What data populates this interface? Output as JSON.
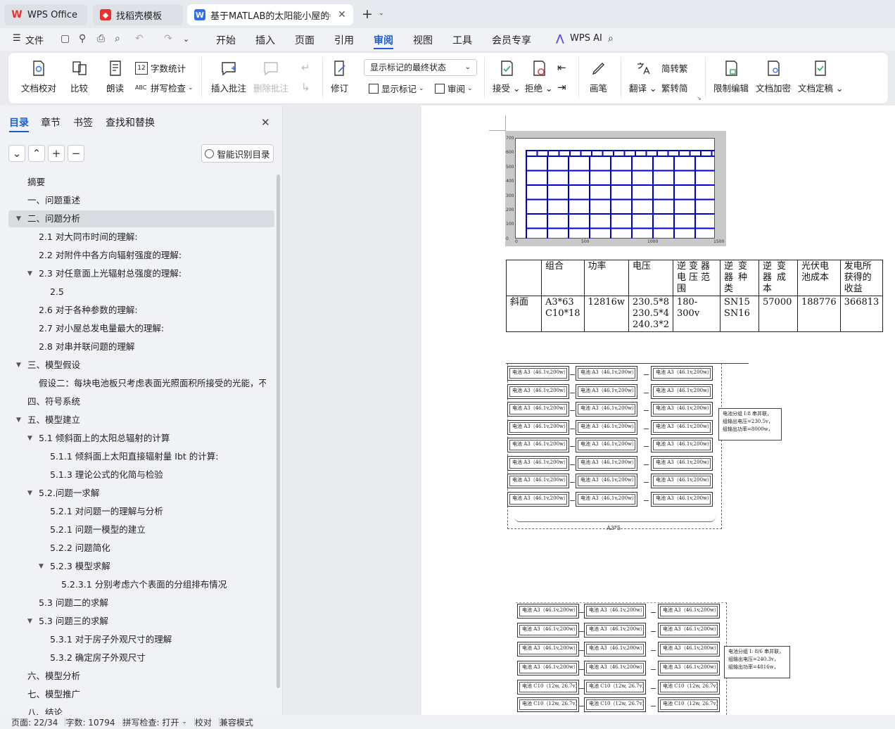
{
  "tabs": [
    {
      "label": "WPS Office"
    },
    {
      "label": "找稻壳模板"
    },
    {
      "label": "基于MATLAB的太阳能小屋的"
    }
  ],
  "menu": {
    "file": "文件",
    "items": [
      "开始",
      "插入",
      "页面",
      "引用",
      "审阅",
      "视图",
      "工具",
      "会员专享"
    ],
    "active": "审阅",
    "ai": "WPS AI"
  },
  "ribbon": {
    "doc_check": "文档校对",
    "compare": "比较",
    "read_aloud": "朗读",
    "word_count": "字数统计",
    "spell_check": "拼写检查",
    "insert_comment": "插入批注",
    "delete_comment": "删除批注",
    "revise": "修订",
    "show_markup_state": "显示标记的最终状态",
    "show_markup": "显示标记",
    "review": "审阅",
    "accept": "接受",
    "reject": "拒绝",
    "pen": "画笔",
    "translate": "翻译",
    "to_traditional": "简转繁",
    "to_simplified": "繁转简",
    "restrict_edit": "限制编辑",
    "encrypt": "文档加密",
    "finalize": "文档定稿"
  },
  "nav": {
    "tabs": [
      "目录",
      "章节",
      "书签",
      "查找和替换"
    ],
    "smart_btn": "智能识别目录",
    "items": [
      {
        "text": "摘要",
        "level": 1,
        "arrow": false
      },
      {
        "text": "一、问题重述",
        "level": 1,
        "arrow": false
      },
      {
        "text": "二、问题分析",
        "level": 1,
        "arrow": true,
        "selected": true
      },
      {
        "text": "2.1 对大同市时间的理解:",
        "level": 2,
        "arrow": false
      },
      {
        "text": "2.2 对附件中各方向辐射强度的理解:",
        "level": 2,
        "arrow": false
      },
      {
        "text": "2.3 对任意面上光辐射总强度的理解:",
        "level": 2,
        "arrow": true
      },
      {
        "text": "2.5",
        "level": 3,
        "arrow": false
      },
      {
        "text": "2.6 对于各种参数的理解:",
        "level": 2,
        "arrow": false
      },
      {
        "text": "2.7 对小屋总发电量最大的理解:",
        "level": 2,
        "arrow": false
      },
      {
        "text": "2.8 对串并联问题的理解",
        "level": 2,
        "arrow": false
      },
      {
        "text": "三、模型假设",
        "level": 1,
        "arrow": true
      },
      {
        "text": "假设二：每块电池板只考虑表面光照面积所接受的光能，不...",
        "level": 2,
        "arrow": false
      },
      {
        "text": "四、符号系统",
        "level": 1,
        "arrow": false
      },
      {
        "text": "五、模型建立",
        "level": 1,
        "arrow": true
      },
      {
        "text": "5.1 倾斜面上的太阳总辐射的计算",
        "level": 2,
        "arrow": true
      },
      {
        "text": "5.1.1 倾斜面上太阳直接辐射量 Ibt 的计算:",
        "level": 3,
        "arrow": false
      },
      {
        "text": "5.1.3 理论公式的化简与检验",
        "level": 3,
        "arrow": false
      },
      {
        "text": "5.2.问题一求解",
        "level": 2,
        "arrow": true
      },
      {
        "text": "5.2.1 对问题一的理解与分析",
        "level": 3,
        "arrow": false
      },
      {
        "text": "5.2.1 问题一模型的建立",
        "level": 3,
        "arrow": false
      },
      {
        "text": "5.2.2 问题简化",
        "level": 3,
        "arrow": false
      },
      {
        "text": "5.2.3 模型求解",
        "level": 3,
        "arrow": true
      },
      {
        "text": "5.2.3.1 分别考虑六个表面的分组排布情况",
        "level": 4,
        "arrow": false
      },
      {
        "text": "5.3 问题二的求解",
        "level": 2,
        "arrow": false
      },
      {
        "text": "5.3 问题三的求解",
        "level": 2,
        "arrow": true
      },
      {
        "text": "5.3.1 对于房子外观尺寸的理解",
        "level": 3,
        "arrow": false
      },
      {
        "text": "5.3.2 确定房子外观尺寸",
        "level": 3,
        "arrow": false
      },
      {
        "text": "六、模型分析",
        "level": 1,
        "arrow": false
      },
      {
        "text": "七、模型推广",
        "level": 1,
        "arrow": false
      },
      {
        "text": "八、结论",
        "level": 1,
        "arrow": false
      }
    ]
  },
  "document": {
    "plot_y_ticks": [
      "700",
      "600",
      "500",
      "400",
      "300",
      "200",
      "100",
      "0"
    ],
    "plot_x_ticks": [
      "0",
      "500",
      "1000",
      "1500"
    ],
    "table_header": [
      "",
      "组合",
      "功率",
      "电压",
      "逆变器电压范围",
      "逆变器种类",
      "逆变器成本",
      "光伏电池成本",
      "发电所获得的收益"
    ],
    "table_row": [
      "斜面",
      "A3*63\nC10*18",
      "12816w",
      "230.5*8\n230.5*4\n240.3*2",
      "180-300v",
      "SN15\nSN16",
      "57000",
      "188776",
      "366813"
    ],
    "cell_a3": "电池 A3（46.1v,200w）",
    "cell_c10": "电池 C10（12w, 26.7v）",
    "note1": [
      "电池分组 I:8 串并联，",
      "组输出电压=230.5v，",
      "组输出功率=8000w，"
    ],
    "note2": [
      "电池分组 I: 8/6 串并联，",
      "组输出电压=240.3v，",
      "组输出功率=4816w，"
    ],
    "brace_label": "A3*5"
  },
  "status": {
    "page": "页面: 22/34",
    "words": "字数: 10794",
    "spell": "拼写检查: 打开",
    "proof": "校对",
    "compat": "兼容模式"
  }
}
